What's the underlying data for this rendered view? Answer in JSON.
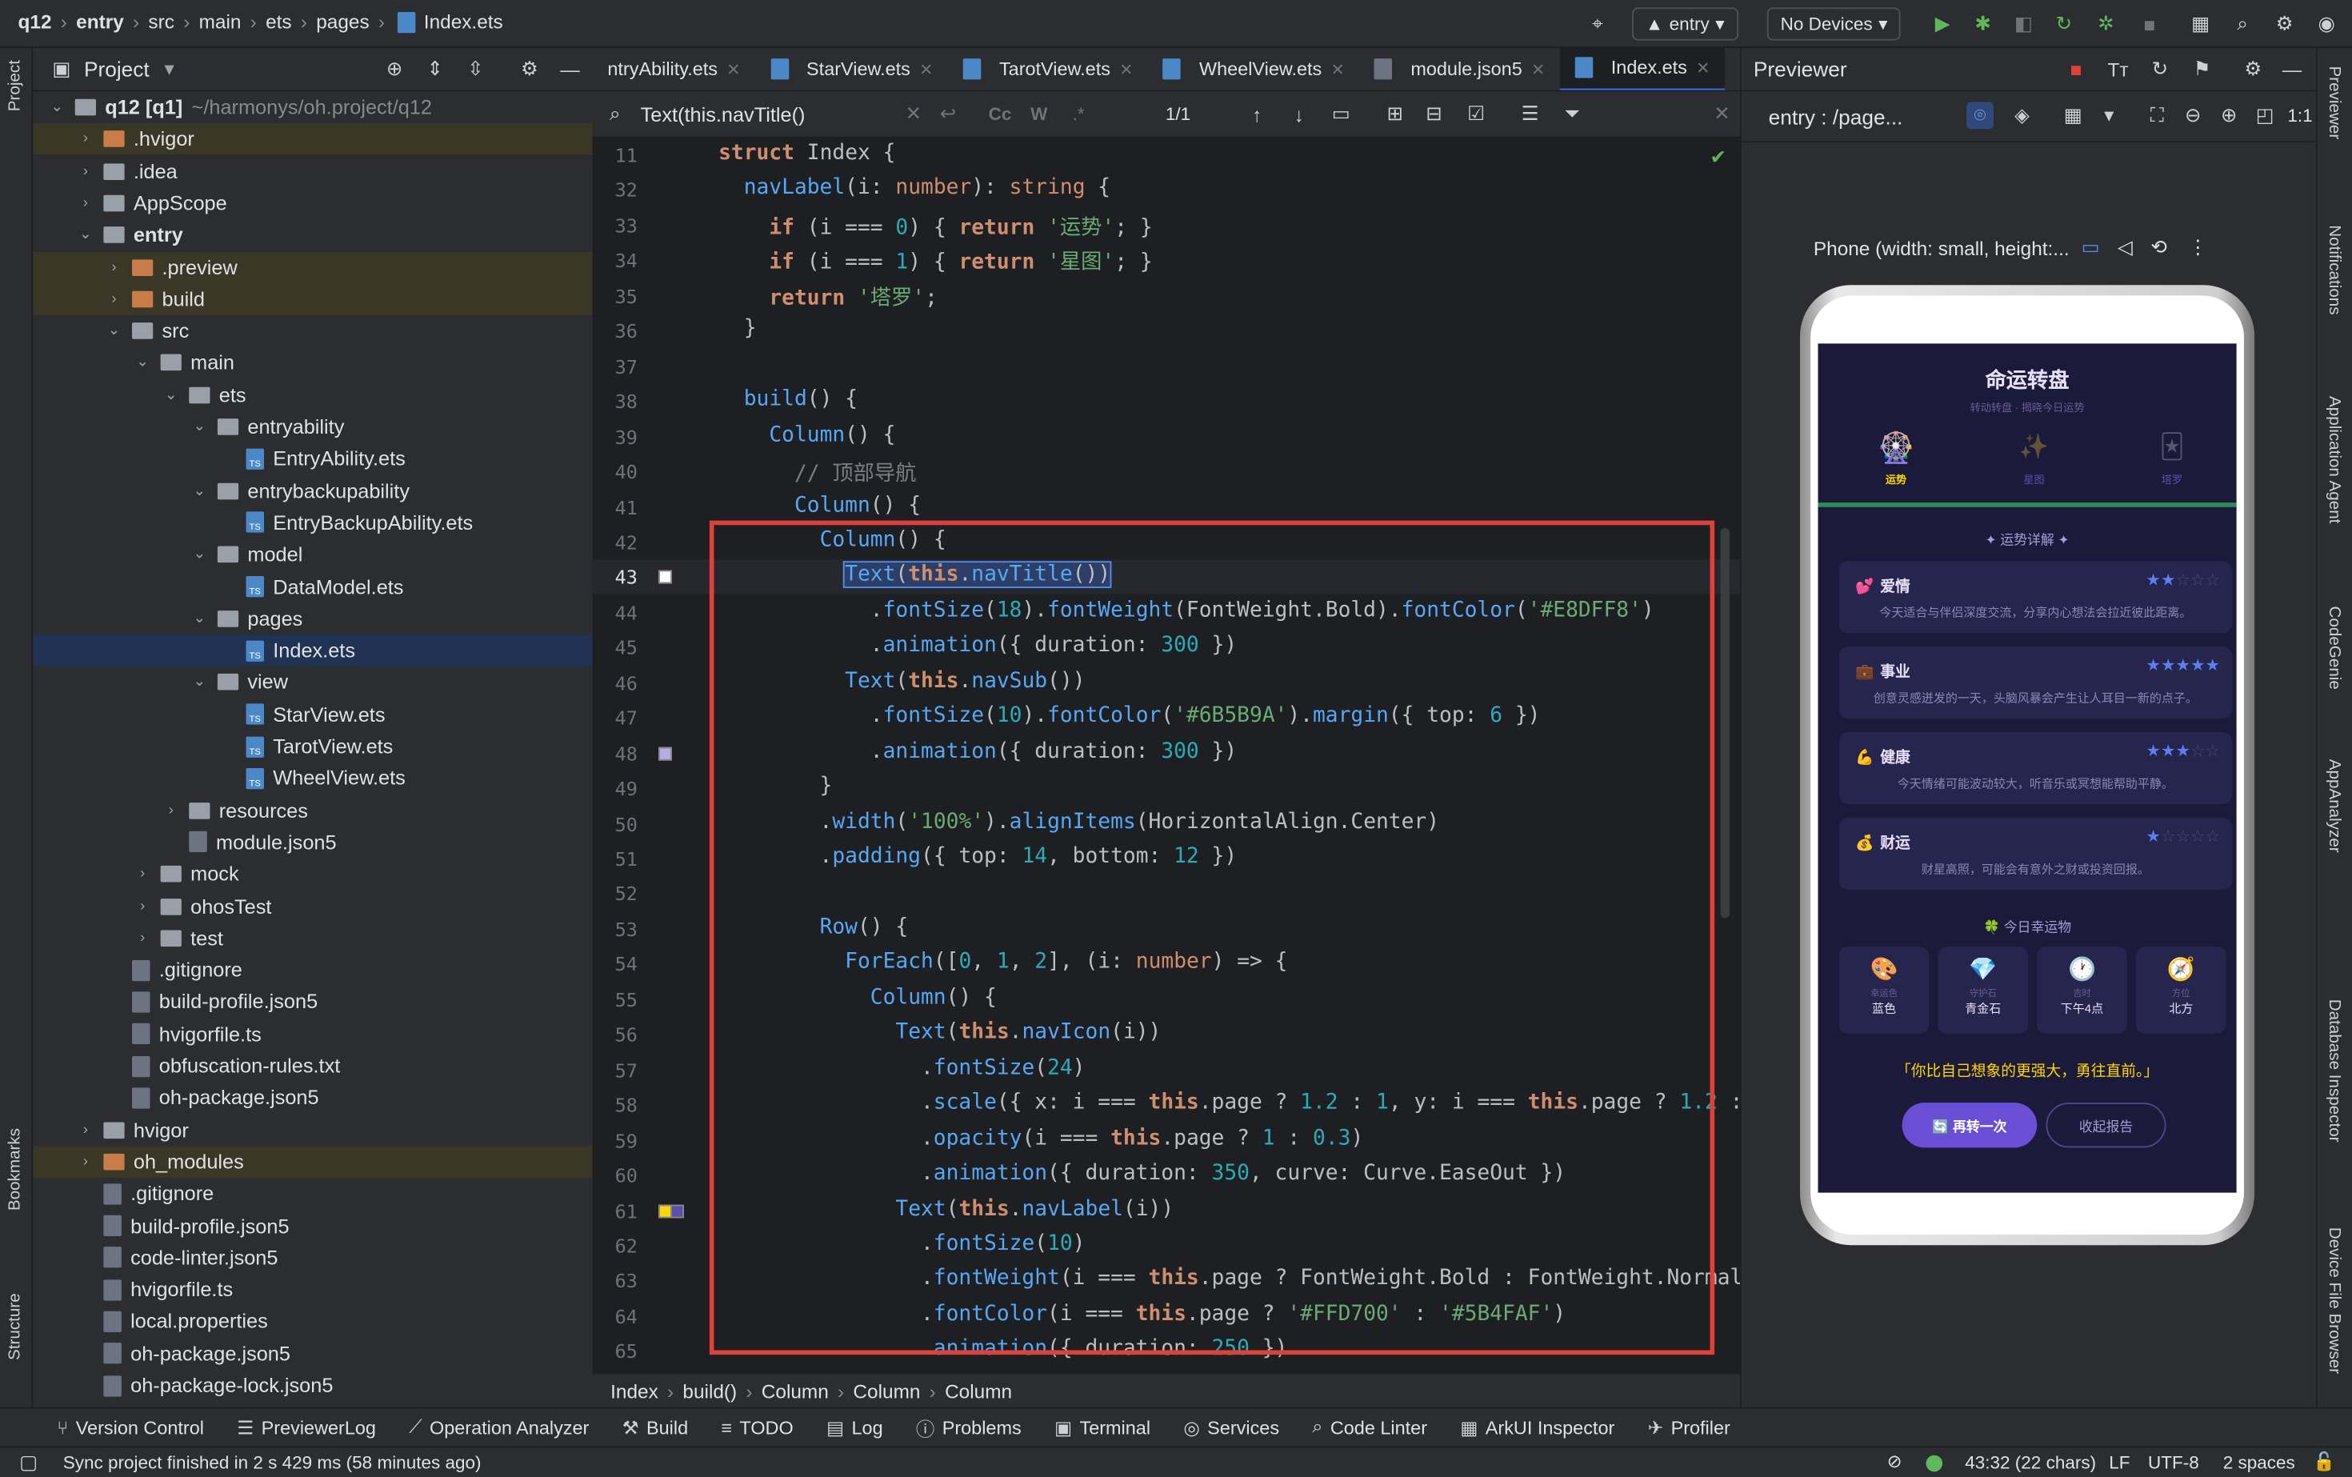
{
  "titlebar": {
    "crumbs": [
      "q12",
      "entry",
      "src",
      "main",
      "ets",
      "pages",
      "Index.ets"
    ],
    "run_config": "entry",
    "devices": "No Devices"
  },
  "leftstrip": {
    "project": "Project",
    "bookmarks": "Bookmarks",
    "structure": "Structure"
  },
  "rightstrip": {
    "items": [
      "Previewer",
      "Notifications",
      "Application Agent",
      "CodeGenie",
      "AppAnalyzer",
      "Database Inspector",
      "Device File Browser"
    ]
  },
  "project": {
    "title": "Project",
    "tree": [
      {
        "label": "q12 [q1]",
        "extra": "~/harmonys/oh.project/q12",
        "depth": 0,
        "type": "module",
        "open": true
      },
      {
        "label": ".hvigor",
        "depth": 1,
        "type": "folder-o",
        "open": false
      },
      {
        "label": ".idea",
        "depth": 1,
        "type": "folder",
        "open": false
      },
      {
        "label": "AppScope",
        "depth": 1,
        "type": "folder",
        "open": false
      },
      {
        "label": "entry",
        "depth": 1,
        "type": "module",
        "open": true,
        "bold": true
      },
      {
        "label": ".preview",
        "depth": 2,
        "type": "folder-o",
        "open": false
      },
      {
        "label": "build",
        "depth": 2,
        "type": "folder-o",
        "open": false
      },
      {
        "label": "src",
        "depth": 2,
        "type": "folder",
        "open": true
      },
      {
        "label": "main",
        "depth": 3,
        "type": "folder",
        "open": true
      },
      {
        "label": "ets",
        "depth": 4,
        "type": "folder",
        "open": true
      },
      {
        "label": "entryability",
        "depth": 5,
        "type": "folder",
        "open": true
      },
      {
        "label": "EntryAbility.ets",
        "depth": 6,
        "type": "ts"
      },
      {
        "label": "entrybackupability",
        "depth": 5,
        "type": "folder",
        "open": true
      },
      {
        "label": "EntryBackupAbility.ets",
        "depth": 6,
        "type": "ts"
      },
      {
        "label": "model",
        "depth": 5,
        "type": "folder",
        "open": true
      },
      {
        "label": "DataModel.ets",
        "depth": 6,
        "type": "ts"
      },
      {
        "label": "pages",
        "depth": 5,
        "type": "folder",
        "open": true
      },
      {
        "label": "Index.ets",
        "depth": 6,
        "type": "ts",
        "selected": true
      },
      {
        "label": "view",
        "depth": 5,
        "type": "folder",
        "open": true
      },
      {
        "label": "StarView.ets",
        "depth": 6,
        "type": "ts"
      },
      {
        "label": "TarotView.ets",
        "depth": 6,
        "type": "ts"
      },
      {
        "label": "WheelView.ets",
        "depth": 6,
        "type": "ts"
      },
      {
        "label": "resources",
        "depth": 4,
        "type": "folder",
        "open": false
      },
      {
        "label": "module.json5",
        "depth": 4,
        "type": "file"
      },
      {
        "label": "mock",
        "depth": 3,
        "type": "folder",
        "open": false
      },
      {
        "label": "ohosTest",
        "depth": 3,
        "type": "folder",
        "open": false
      },
      {
        "label": "test",
        "depth": 3,
        "type": "folder",
        "open": false
      },
      {
        "label": ".gitignore",
        "depth": 2,
        "type": "file"
      },
      {
        "label": "build-profile.json5",
        "depth": 2,
        "type": "file"
      },
      {
        "label": "hvigorfile.ts",
        "depth": 2,
        "type": "file"
      },
      {
        "label": "obfuscation-rules.txt",
        "depth": 2,
        "type": "file"
      },
      {
        "label": "oh-package.json5",
        "depth": 2,
        "type": "file"
      },
      {
        "label": "hvigor",
        "depth": 1,
        "type": "folder",
        "open": false
      },
      {
        "label": "oh_modules",
        "depth": 1,
        "type": "folder-o",
        "open": false
      },
      {
        "label": ".gitignore",
        "depth": 1,
        "type": "file"
      },
      {
        "label": "build-profile.json5",
        "depth": 1,
        "type": "file"
      },
      {
        "label": "code-linter.json5",
        "depth": 1,
        "type": "file"
      },
      {
        "label": "hvigorfile.ts",
        "depth": 1,
        "type": "file"
      },
      {
        "label": "local.properties",
        "depth": 1,
        "type": "file"
      },
      {
        "label": "oh-package.json5",
        "depth": 1,
        "type": "file"
      },
      {
        "label": "oh-package-lock.json5",
        "depth": 1,
        "type": "file"
      }
    ]
  },
  "tabs": [
    "ntryAbility.ets",
    "StarView.ets",
    "TarotView.ets",
    "WheelView.ets",
    "module.json5",
    "Index.ets"
  ],
  "search": {
    "query": "Text(this.navTitle()",
    "count": "1/1"
  },
  "editor": {
    "lines": [
      {
        "n": "11",
        "h": "<span class='k'>struct</span> <span class='t' style='color:#bcbec4'>Index</span> {"
      },
      {
        "n": "32",
        "h": "  <span class='f'>navLabel</span>(i: <span class='ty'>number</span>): <span class='ty'>string</span> {"
      },
      {
        "n": "33",
        "h": "    <span class='k'>if</span> (i === <span class='n'>0</span>) { <span class='k'>return</span> <span class='s'>'运势'</span>; }"
      },
      {
        "n": "34",
        "h": "    <span class='k'>if</span> (i === <span class='n'>1</span>) { <span class='k'>return</span> <span class='s'>'星图'</span>; }"
      },
      {
        "n": "35",
        "h": "    <span class='k'>return</span> <span class='s'>'塔罗'</span>;"
      },
      {
        "n": "36",
        "h": "  }"
      },
      {
        "n": "37",
        "h": ""
      },
      {
        "n": "38",
        "h": "  <span class='f'>build</span>() {"
      },
      {
        "n": "39",
        "h": "    <span class='f'>Column</span>() {"
      },
      {
        "n": "40",
        "h": "      <span class='c'>// 顶部导航</span>"
      },
      {
        "n": "41",
        "h": "      <span class='f'>Column</span>() {"
      },
      {
        "n": "42",
        "h": "        <span class='f'>Column</span>() {"
      },
      {
        "n": "43",
        "h": "          <span style='outline:1px solid #4f8ef7;background:#2d3f66'><span class='f'>Text</span>(<span class='k'>this</span>.<span class='f'>navTitle</span>())</span>"
      },
      {
        "n": "44",
        "h": "            .<span class='f'>fontSize</span>(<span class='n'>18</span>).<span class='f'>fontWeight</span>(FontWeight.Bold).<span class='f'>fontColor</span>(<span class='s'>'#E8DFF8'</span>)"
      },
      {
        "n": "45",
        "h": "            .<span class='f'>animation</span>({ duration: <span class='n'>300</span> })"
      },
      {
        "n": "46",
        "h": "          <span class='f'>Text</span>(<span class='k'>this</span>.<span class='f'>navSub</span>())"
      },
      {
        "n": "47",
        "h": "            .<span class='f'>fontSize</span>(<span class='n'>10</span>).<span class='f'>fontColor</span>(<span class='s'>'#6B5B9A'</span>).<span class='f'>margin</span>({ top: <span class='n'>6</span> })"
      },
      {
        "n": "48",
        "h": "            .<span class='f'>animation</span>({ duration: <span class='n'>300</span> })"
      },
      {
        "n": "49",
        "h": "        }"
      },
      {
        "n": "50",
        "h": "        .<span class='f'>width</span>(<span class='s'>'100%'</span>).<span class='f'>alignItems</span>(HorizontalAlign.Center)"
      },
      {
        "n": "51",
        "h": "        .<span class='f'>padding</span>({ top: <span class='n'>14</span>, bottom: <span class='n'>12</span> })"
      },
      {
        "n": "52",
        "h": ""
      },
      {
        "n": "53",
        "h": "        <span class='f'>Row</span>() {"
      },
      {
        "n": "54",
        "h": "          <span class='f'>ForEach</span>([<span class='n'>0</span>, <span class='n'>1</span>, <span class='n'>2</span>], (i: <span class='ty'>number</span>) => {"
      },
      {
        "n": "55",
        "h": "            <span class='f'>Column</span>() {"
      },
      {
        "n": "56",
        "h": "              <span class='f'>Text</span>(<span class='k'>this</span>.<span class='f'>navIcon</span>(i))"
      },
      {
        "n": "57",
        "h": "                .<span class='f'>fontSize</span>(<span class='n'>24</span>)"
      },
      {
        "n": "58",
        "h": "                .<span class='f'>scale</span>({ x: i === <span class='k'>this</span>.page ? <span class='n'>1.2</span> : <span class='n'>1</span>, y: i === <span class='k'>this</span>.page ? <span class='n'>1.2</span> :"
      },
      {
        "n": "59",
        "h": "                .<span class='f'>opacity</span>(i === <span class='k'>this</span>.page ? <span class='n'>1</span> : <span class='n'>0.3</span>)"
      },
      {
        "n": "60",
        "h": "                .<span class='f'>animation</span>({ duration: <span class='n'>350</span>, curve: Curve.EaseOut })"
      },
      {
        "n": "61",
        "h": "              <span class='f'>Text</span>(<span class='k'>this</span>.<span class='f'>navLabel</span>(i))"
      },
      {
        "n": "62",
        "h": "                .<span class='f'>fontSize</span>(<span class='n'>10</span>)"
      },
      {
        "n": "63",
        "h": "                .<span class='f'>fontWeight</span>(i === <span class='k'>this</span>.page ? FontWeight.Bold : FontWeight.Normal)"
      },
      {
        "n": "64",
        "h": "                .<span class='f'>fontColor</span>(i === <span class='k'>this</span>.page ? <span class='s'>'#FFD700'</span> : <span class='s'>'#5B4FAF'</span>)"
      },
      {
        "n": "65",
        "h": "                .<span class='f'>animation</span>({ duration: <span class='n'>250</span> })"
      }
    ]
  },
  "breadcrumb": [
    "Index",
    "build()",
    "Column",
    "Column",
    "Column"
  ],
  "previewer": {
    "title": "Previewer",
    "route": "entry : /page...",
    "device": "Phone (width: small, height:..."
  },
  "app": {
    "title": "命运转盘",
    "subtitle": "转动转盘 · 揭晓今日运势",
    "nav": [
      {
        "icon": "🎡",
        "label": "运势"
      },
      {
        "icon": "✨",
        "label": "星图"
      },
      {
        "icon": "🃏",
        "label": "塔罗"
      }
    ],
    "section": "✦ 运势详解 ✦",
    "cards": [
      {
        "icon": "💕",
        "title": "爱情",
        "stars": 2,
        "desc": "今天适合与伴侣深度交流，分享内心想法会拉近彼此距离。"
      },
      {
        "icon": "💼",
        "title": "事业",
        "stars": 5,
        "desc": "创意灵感迸发的一天，头脑风暴会产生让人耳目一新的点子。"
      },
      {
        "icon": "💪",
        "title": "健康",
        "stars": 3,
        "desc": "今天情绪可能波动较大，听音乐或冥想能帮助平静。"
      },
      {
        "icon": "💰",
        "title": "财运",
        "stars": 1,
        "desc": "财星高照，可能会有意外之财或投资回报。"
      }
    ],
    "lucky_title": "🍀 今日幸运物",
    "lucky": [
      {
        "icon": "🎨",
        "k": "幸运色",
        "v": "蓝色"
      },
      {
        "icon": "💎",
        "k": "守护石",
        "v": "青金石"
      },
      {
        "icon": "🕐",
        "k": "吉时",
        "v": "下午4点"
      },
      {
        "icon": "🧭",
        "k": "方位",
        "v": "北方"
      }
    ],
    "quote": "「你比自己想象的更强大，勇往直前。」",
    "btn_primary": "🔄 再转一次",
    "btn_secondary": "收起报告"
  },
  "bottombar": [
    "Version Control",
    "PreviewerLog",
    "Operation Analyzer",
    "Build",
    "TODO",
    "Log",
    "Problems",
    "Terminal",
    "Services",
    "Code Linter",
    "ArkUI Inspector",
    "Profiler"
  ],
  "status": {
    "message": "Sync project finished in 2 s 429 ms (58 minutes ago)",
    "position": "43:32 (22 chars)",
    "line_sep": "LF",
    "encoding": "UTF-8",
    "indent": "2 spaces"
  }
}
